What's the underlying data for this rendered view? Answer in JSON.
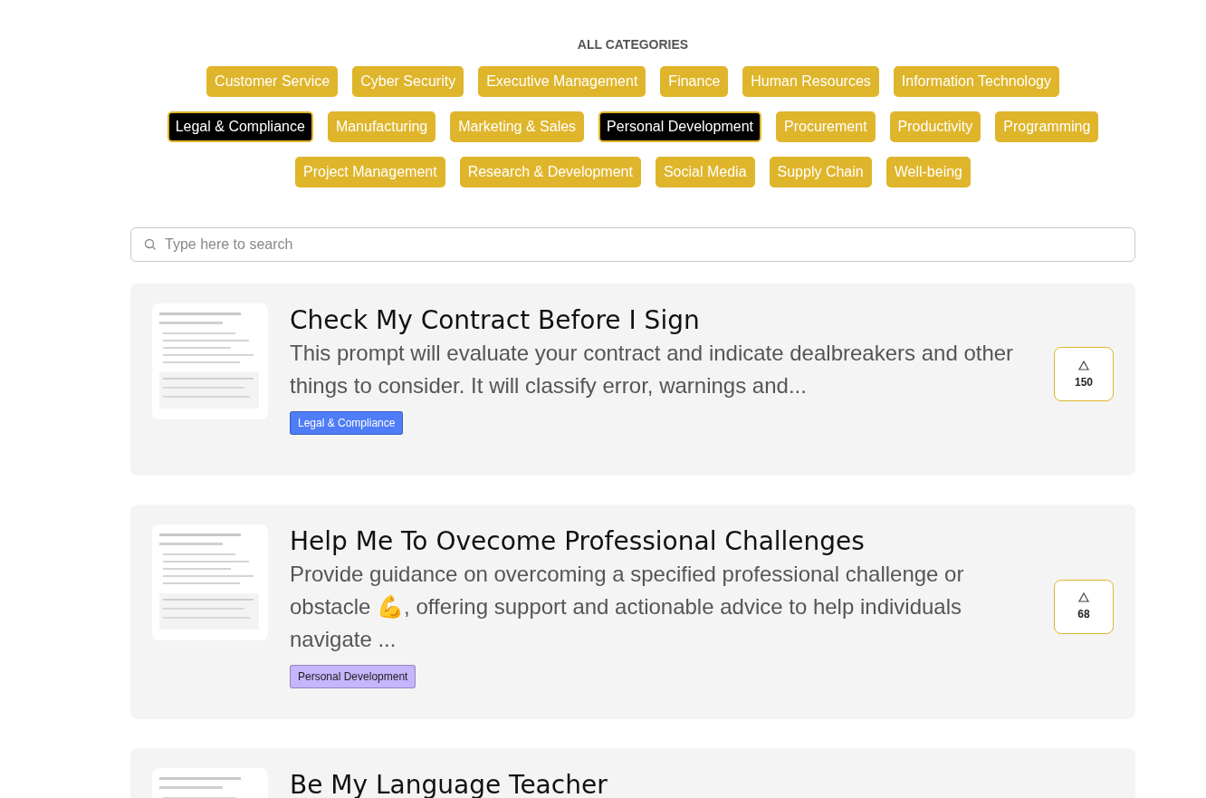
{
  "categories_heading": "ALL CATEGORIES",
  "categories": [
    {
      "label": "Customer Service",
      "selected": false
    },
    {
      "label": "Cyber Security",
      "selected": false
    },
    {
      "label": "Executive Management",
      "selected": false
    },
    {
      "label": "Finance",
      "selected": false
    },
    {
      "label": "Human Resources",
      "selected": false
    },
    {
      "label": "Information Technology",
      "selected": false
    },
    {
      "label": "Legal & Compliance",
      "selected": true
    },
    {
      "label": "Manufacturing",
      "selected": false
    },
    {
      "label": "Marketing & Sales",
      "selected": false
    },
    {
      "label": "Personal Development",
      "selected": true
    },
    {
      "label": "Procurement",
      "selected": false
    },
    {
      "label": "Productivity",
      "selected": false
    },
    {
      "label": "Programming",
      "selected": false
    },
    {
      "label": "Project Management",
      "selected": false
    },
    {
      "label": "Research & Development",
      "selected": false
    },
    {
      "label": "Social Media",
      "selected": false
    },
    {
      "label": "Supply Chain",
      "selected": false
    },
    {
      "label": "Well-being",
      "selected": false
    }
  ],
  "search": {
    "placeholder": "Type here to search"
  },
  "prompts": [
    {
      "title": "Check My Contract Before I Sign",
      "description": "This prompt will evaluate your contract and indicate dealbreakers and other things to consider. It will classify error, warnings and...",
      "tag": {
        "label": "Legal & Compliance",
        "color": "#4f7cf7"
      },
      "votes": "150"
    },
    {
      "title": "Help Me To Ovecome Professional Challenges",
      "description": "Provide guidance on overcoming a specified professional challenge or obstacle 💪, offering support and actionable advice to help individuals navigate ...",
      "tag": {
        "label": "Personal Development",
        "color": "#c4b5fd"
      },
      "votes": "68"
    },
    {
      "title": "Be My Language Teacher"
    }
  ]
}
